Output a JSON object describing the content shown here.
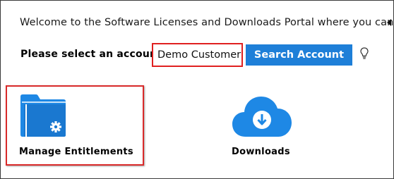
{
  "portal": {
    "welcome_text": "Welcome to the Software Licenses and Downloads Portal where you can ac"
  },
  "account": {
    "label": "Please select an account:",
    "input_value": "Demo Customer",
    "search_button_label": "Search Account",
    "hint_icon": "lightbulb-icon"
  },
  "tiles": {
    "manage": {
      "label": "Manage Entitlements",
      "icon": "folder-gear-icon"
    },
    "downloads": {
      "label": "Downloads",
      "icon": "cloud-download-icon"
    }
  },
  "colors": {
    "accent_blue": "#1e7fd8",
    "highlight_red": "#e02020",
    "icon_blue": "#1e88e5"
  }
}
